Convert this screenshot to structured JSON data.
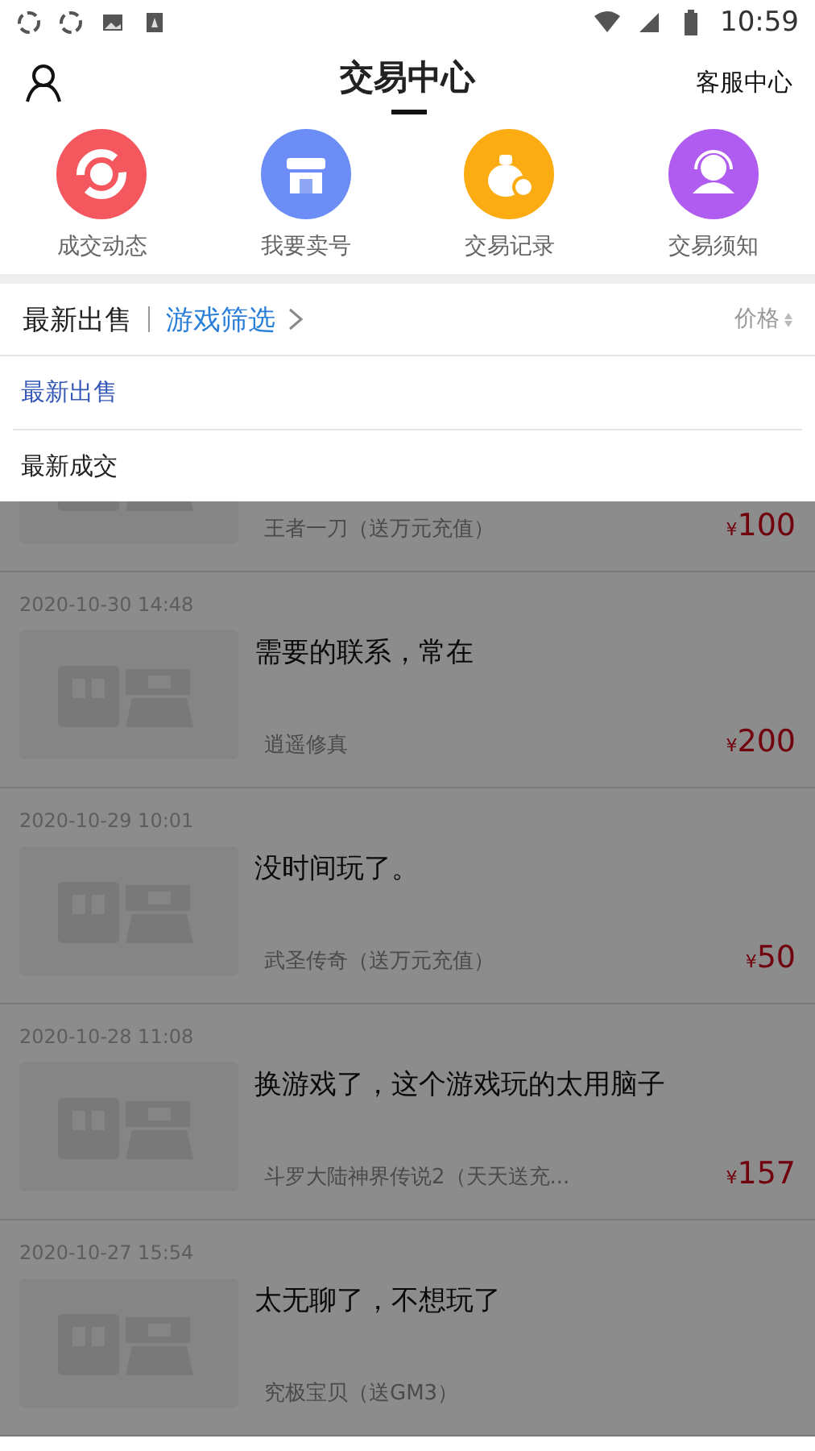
{
  "status_bar": {
    "time": "10:59"
  },
  "header": {
    "title": "交易中心",
    "right_link": "客服中心"
  },
  "shortcuts": [
    {
      "label": "成交动态",
      "kind": "exchange",
      "color": "#f4575d"
    },
    {
      "label": "我要卖号",
      "kind": "shop",
      "color": "#6b8df5"
    },
    {
      "label": "交易记录",
      "kind": "moneybag",
      "color": "#fbac12"
    },
    {
      "label": "交易须知",
      "kind": "support",
      "color": "#b05cf0"
    }
  ],
  "filter_bar": {
    "sort_label": "最新出售",
    "game_filter": "游戏筛选",
    "price_label": "价格"
  },
  "sort_menu": [
    {
      "label": "最新出售",
      "selected": true
    },
    {
      "label": "最新成交",
      "selected": false
    }
  ],
  "listings": [
    {
      "game": "王者一刀（送万元充值）",
      "currency": "¥",
      "price": "100"
    },
    {
      "date": "2020-10-30 14:48",
      "title": "需要的联系，常在",
      "game": "逍遥修真",
      "currency": "¥",
      "price": "200"
    },
    {
      "date": "2020-10-29 10:01",
      "title": "没时间玩了。",
      "game": "武圣传奇（送万元充值）",
      "currency": "¥",
      "price": "50"
    },
    {
      "date": "2020-10-28 11:08",
      "title": "换游戏了，这个游戏玩的太用脑子",
      "game": "斗罗大陆神界传说2（天天送充...",
      "currency": "¥",
      "price": "157"
    },
    {
      "date": "2020-10-27 15:54",
      "title": "太无聊了，不想玩了",
      "game": "究极宝贝（送GM3）"
    }
  ]
}
